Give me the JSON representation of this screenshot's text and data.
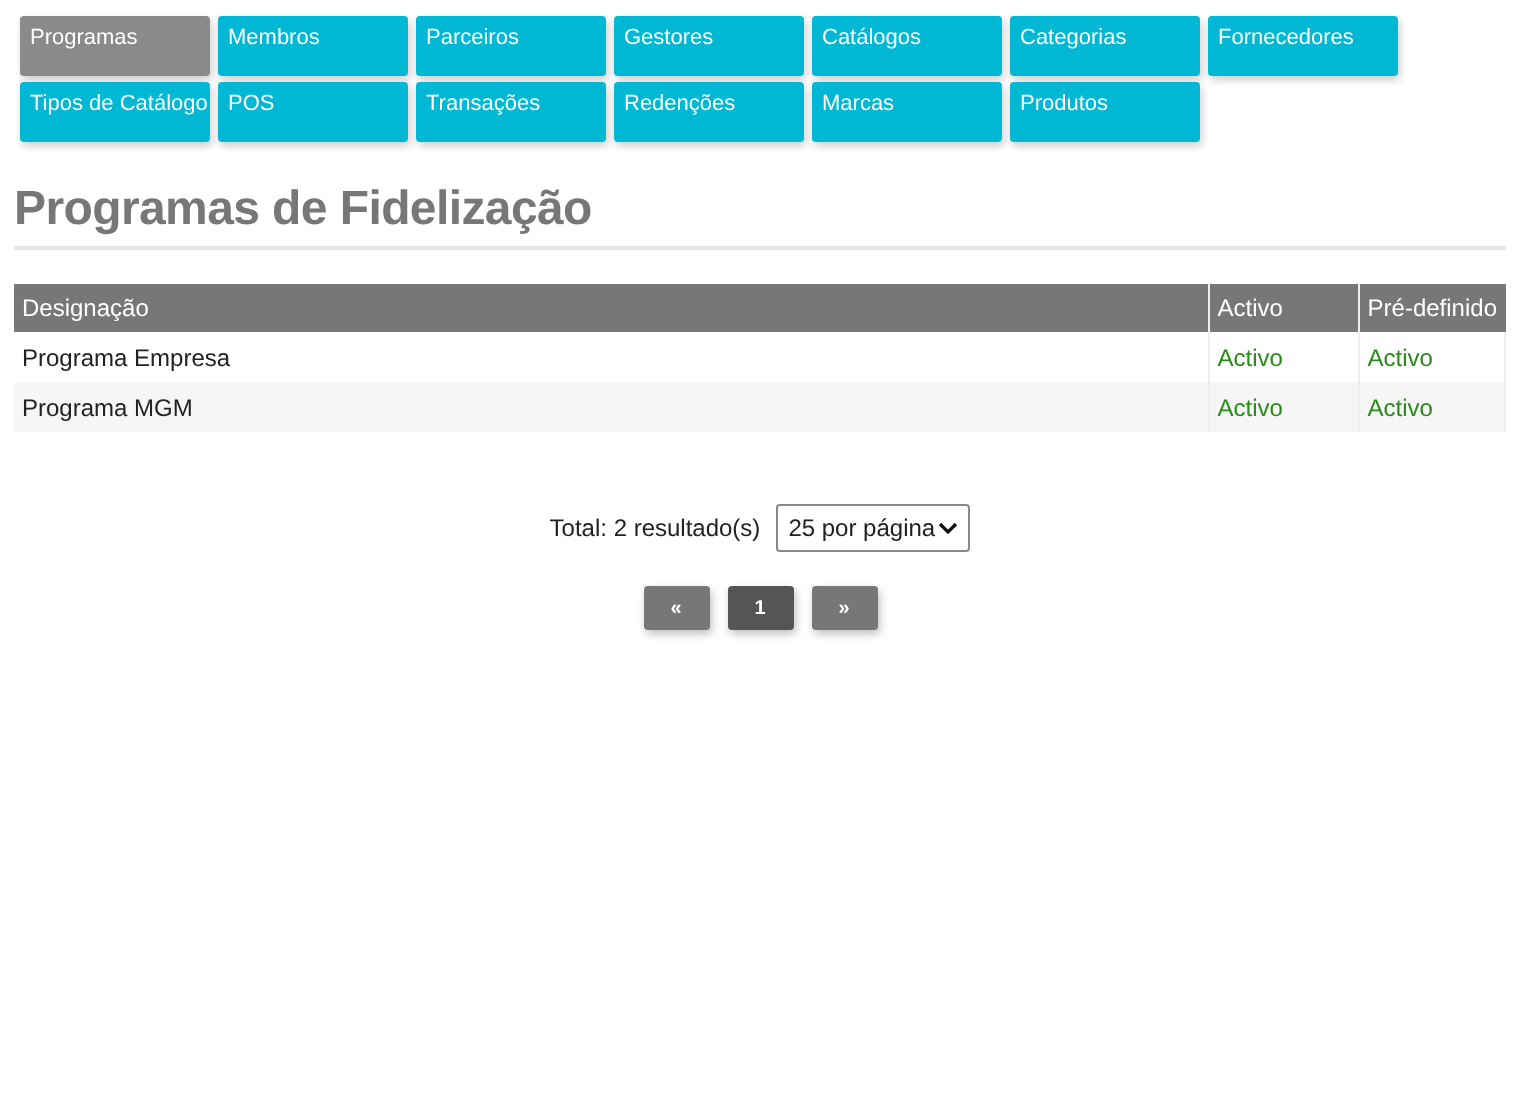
{
  "nav": [
    {
      "label": "Programas",
      "selected": true
    },
    {
      "label": "Membros",
      "selected": false
    },
    {
      "label": "Parceiros",
      "selected": false
    },
    {
      "label": "Gestores",
      "selected": false
    },
    {
      "label": "Catálogos",
      "selected": false
    },
    {
      "label": "Categorias",
      "selected": false
    },
    {
      "label": "Fornecedores",
      "selected": false
    },
    {
      "label": "Tipos de Catálogo",
      "selected": false
    },
    {
      "label": "POS",
      "selected": false
    },
    {
      "label": "Transações",
      "selected": false
    },
    {
      "label": "Redenções",
      "selected": false
    },
    {
      "label": "Marcas",
      "selected": false
    },
    {
      "label": "Produtos",
      "selected": false
    }
  ],
  "page_title": "Programas de Fidelização",
  "table": {
    "columns": [
      "Designação",
      "Activo",
      "Pré-definido"
    ],
    "rows": [
      {
        "cells": [
          "Programa Empresa",
          "Activo",
          "Activo"
        ]
      },
      {
        "cells": [
          "Programa MGM",
          "Activo",
          "Activo"
        ]
      }
    ]
  },
  "pagination": {
    "total": "Total: 2 resultado(s)",
    "page_size": "25 por página",
    "buttons": [
      {
        "label": "«",
        "selected": false
      },
      {
        "label": "1",
        "selected": true
      },
      {
        "label": "»",
        "selected": false
      }
    ]
  }
}
